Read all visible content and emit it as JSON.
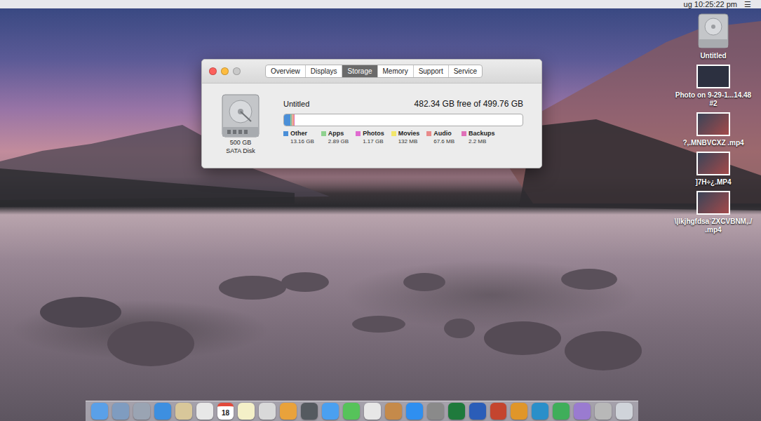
{
  "menu_bar": {
    "clock": "ug 10:25:22 pm",
    "menu_icon": "☰"
  },
  "window": {
    "tabs": [
      {
        "label": "Overview",
        "selected": false
      },
      {
        "label": "Displays",
        "selected": false
      },
      {
        "label": "Storage",
        "selected": true
      },
      {
        "label": "Memory",
        "selected": false
      },
      {
        "label": "Support",
        "selected": false
      },
      {
        "label": "Service",
        "selected": false
      }
    ],
    "disk": {
      "size": "500 GB",
      "type": "SATA Disk"
    },
    "volume": {
      "name": "Untitled",
      "free": "482.34 GB free of 499.76 GB",
      "categories": [
        {
          "label": "Other",
          "size": "13.16 GB",
          "level": 0.0263,
          "color": "#4a8fd8"
        },
        {
          "label": "Apps",
          "size": "2.89 GB",
          "level": 0.0058,
          "color": "#8fd18f"
        },
        {
          "label": "Photos",
          "size": "1.17 GB",
          "level": 0.0023,
          "color": "#e06bd0"
        },
        {
          "label": "Movies",
          "size": "132 MB",
          "level": 0.0003,
          "color": "#f2e66b"
        },
        {
          "label": "Audio",
          "size": "67.6 MB",
          "level": 0.0001,
          "color": "#e88a8a"
        },
        {
          "label": "Backups",
          "size": "2.2 MB",
          "level": 0.0001,
          "color": "#e070b8"
        }
      ]
    }
  },
  "desktop_icons": [
    {
      "label": "Untitled",
      "kind": "disk"
    },
    {
      "label": "Photo on 9-29-1...14.48 #2",
      "kind": "photo"
    },
    {
      "label": "?,.MNBVCXZ .mp4",
      "kind": "video"
    },
    {
      "label": "]7H÷¿.MP4",
      "kind": "video"
    },
    {
      "label": "\\|lkjhgfdsa`ZXCVBNM,./ .mp4",
      "kind": "video"
    }
  ],
  "dock": [
    {
      "kind": "app",
      "color": "#5aa0e8"
    },
    {
      "kind": "app",
      "color": "#7f9cc0"
    },
    {
      "kind": "app",
      "color": "#9aa4b3"
    },
    {
      "kind": "app",
      "color": "#3d8fe0"
    },
    {
      "kind": "app",
      "color": "#d8c79a"
    },
    {
      "kind": "app",
      "color": "#e8e8e8"
    },
    {
      "kind": "calendar",
      "color": "#ffffff",
      "text": "18"
    },
    {
      "kind": "app",
      "color": "#f4f0c8"
    },
    {
      "kind": "app",
      "color": "#d9d9d9"
    },
    {
      "kind": "app",
      "color": "#e9a23b"
    },
    {
      "kind": "app",
      "color": "#555a60"
    },
    {
      "kind": "app",
      "color": "#4aa0f0"
    },
    {
      "kind": "app",
      "color": "#56c35a"
    },
    {
      "kind": "app",
      "color": "#e7e7e7"
    },
    {
      "kind": "app",
      "color": "#c58a4a"
    },
    {
      "kind": "app",
      "color": "#2f8ff0"
    },
    {
      "kind": "app",
      "color": "#8a8a8a"
    },
    {
      "kind": "app",
      "color": "#1f7a3c"
    },
    {
      "kind": "app",
      "color": "#2b5db8"
    },
    {
      "kind": "app",
      "color": "#c4452f"
    },
    {
      "kind": "app",
      "color": "#e0962a"
    },
    {
      "kind": "app",
      "color": "#2a8fc9"
    },
    {
      "kind": "app",
      "color": "#3fae5a"
    },
    {
      "kind": "app",
      "color": "#9a7bd0"
    },
    {
      "kind": "app",
      "color": "#b8b8b8"
    },
    {
      "kind": "app",
      "color": "#d0d4da"
    }
  ]
}
